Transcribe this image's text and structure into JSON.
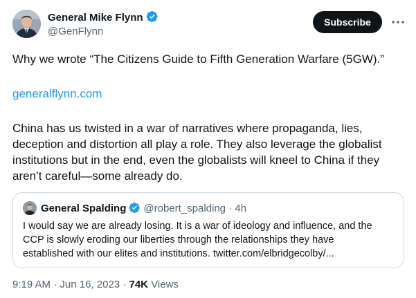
{
  "author": {
    "name": "General Mike Flynn",
    "handle": "@GenFlynn",
    "verified_color": "#1d9bf0"
  },
  "actions": {
    "subscribe_label": "Subscribe",
    "more_icon": "more-horizontal-icon"
  },
  "tweet": {
    "line1": "Why we wrote “The Citizens Guide to Fifth Generation Warfare (5GW).”",
    "link": "generalflynn.com",
    "body_lines": [
      "China has us twisted in a war of narratives where propaganda, lies,",
      "deception and distortion all play a role. They also leverage the globalist",
      "institutions but in the end, even the globalists will kneel to China if they",
      "aren’t careful—some already do."
    ]
  },
  "quote": {
    "name": "General Spalding",
    "handle": "@robert_spalding",
    "separator": "·",
    "age": "4h",
    "lines": [
      "I would say we are already losing. It is a war of ideology and influence, and the",
      "CCP is slowly eroding our liberties through the relationships they have",
      "established with our elites and institutions. twitter.com/elbridgecolby/..."
    ]
  },
  "footer": {
    "time": "9:19 AM",
    "dot1": "·",
    "date": "Jun 16, 2023",
    "dot2": "·",
    "views_count": "74K",
    "views_label": "Views"
  },
  "colors": {
    "text": "#0f1419",
    "secondary": "#536471",
    "link": "#1d9bf0",
    "border": "#cfd9de",
    "button_bg": "#0f1419"
  }
}
